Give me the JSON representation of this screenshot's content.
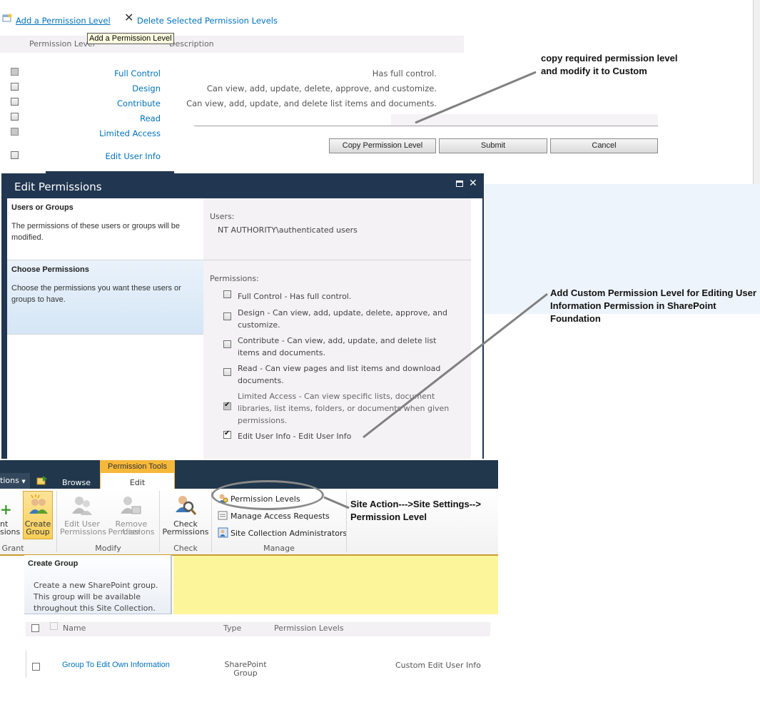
{
  "permission_levels_page": {
    "toolbar": {
      "add_label": "Add a Permission Level",
      "delete_label": "Delete Selected Permission Levels",
      "tooltip": "Add a Permission Level"
    },
    "columns": {
      "level": "Permission Level",
      "description": "Description"
    },
    "rows": [
      {
        "name": "Full Control",
        "description": "Has full control."
      },
      {
        "name": "Design",
        "description": "Can view, add, update, delete, approve, and customize."
      },
      {
        "name": "Contribute",
        "description": "Can view, add, update, and delete list items and documents."
      },
      {
        "name": "Read",
        "description": ""
      },
      {
        "name": "Limited Access",
        "description": ""
      },
      {
        "name": "Edit User Info",
        "description": ""
      }
    ],
    "buttons": {
      "copy": "Copy Permission Level",
      "submit": "Submit",
      "cancel": "Cancel"
    }
  },
  "annotations": {
    "copy_note": "copy required permission level and modify it to Custom",
    "custom_note": "Add Custom Permission Level for Editing User Information  Permission in SharePoint Foundation",
    "path_note": "Site Action--->Site Settings--> Permission Level"
  },
  "edit_permissions_dialog": {
    "title": "Edit Permissions",
    "users_section": {
      "heading": "Users or Groups",
      "help": "The permissions of these users or groups will be modified.",
      "label": "Users:",
      "value": "NT AUTHORITY\\authenticated users"
    },
    "permissions_section": {
      "heading": "Choose Permissions",
      "help": "Choose the permissions you want these users or groups to have.",
      "label": "Permissions:",
      "options": [
        {
          "text": "Full Control - Has full control.",
          "checked": false,
          "disabled": false
        },
        {
          "text": "Design - Can view, add, update, delete, approve, and customize.",
          "checked": false,
          "disabled": false
        },
        {
          "text": "Contribute - Can view, add, update, and delete list items and documents.",
          "checked": false,
          "disabled": false
        },
        {
          "text": "Read - Can view pages and list items and download documents.",
          "checked": false,
          "disabled": false
        },
        {
          "text": "Limited Access - Can view specific lists, document libraries, list items, folders, or documents when given permissions.",
          "checked": true,
          "disabled": true
        },
        {
          "text": "Edit User Info - Edit User Info",
          "checked": true,
          "disabled": false
        }
      ]
    }
  },
  "ribbon": {
    "site_actions_partial": "tions",
    "tabs": {
      "context_group": "Permission Tools",
      "browse": "Browse",
      "edit": "Edit"
    },
    "buttons": {
      "grant_partial_1": "nt",
      "grant_partial_2": "sions",
      "create_group_1": "Create",
      "create_group_2": "Group",
      "edit_user_1": "Edit User",
      "edit_user_2": "Permissions",
      "remove_user_1": "Remove User",
      "remove_user_2": "Permissions",
      "check_1": "Check",
      "check_2": "Permissions",
      "permission_levels": "Permission Levels",
      "manage_access": "Manage Access Requests",
      "site_collection_admins": "Site Collection Administrators"
    },
    "groups": {
      "grant": "Grant",
      "modify": "Modify",
      "check": "Check",
      "manage": "Manage"
    }
  },
  "create_group_tooltip": {
    "title": "Create Group",
    "body": "Create a new SharePoint group. This group will be available throughout this Site Collection."
  },
  "groups_list": {
    "columns": {
      "name": "Name",
      "type": "Type",
      "levels": "Permission Levels"
    },
    "rows": [
      {
        "name": "Group To Edit Own Information",
        "type": "SharePoint Group",
        "levels": "Custom Edit User Info"
      }
    ]
  },
  "colors": {
    "link": "#0072bc",
    "dialog_frame": "#213650",
    "ribbon_dark": "#21374c",
    "context_tab": "#f6b83a",
    "tooltip_yellow": "#fdf59a"
  }
}
